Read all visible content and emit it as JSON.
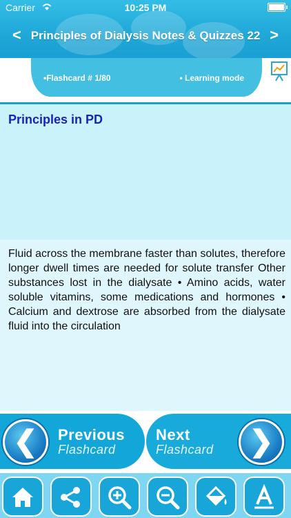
{
  "status": {
    "carrier": "Carrier",
    "time": "10:25 PM"
  },
  "nav": {
    "title": "Principles of Dialysis Notes & Quizzes 22",
    "back": "<",
    "forward": ">"
  },
  "info": {
    "flashcard": "•Flashcard #  1/80",
    "mode": "• Learning mode"
  },
  "question": "Principles in PD",
  "answer": "Fluid across the membrane faster than solutes, therefore longer dwell times are needed for solute transfer  Other substances lost in the dialysate • Amino acids, water soluble vitamins, some medications and hormones • Calcium and dextrose are absorbed from the dialysate fluid into the circulation",
  "buttons": {
    "prev_top": "Previous",
    "prev_bottom": "Flashcard",
    "next_top": "Next",
    "next_bottom": "Flashcard"
  },
  "toolbar": [
    "home-icon",
    "share-icon",
    "zoom-in-icon",
    "zoom-out-icon",
    "paint-bucket-icon",
    "font-icon"
  ],
  "colors": {
    "primary": "#18a6d9",
    "question": "#1a23b8"
  }
}
